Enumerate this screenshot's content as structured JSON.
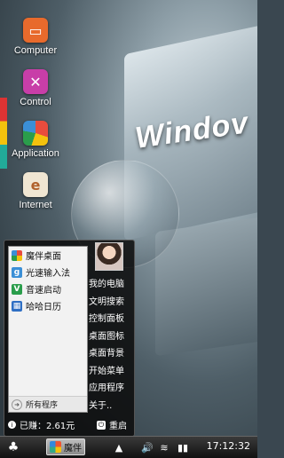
{
  "desktop_icons": [
    {
      "label": "Computer",
      "icon": "computer-icon",
      "color": "#e86a2c"
    },
    {
      "label": "Control",
      "icon": "tools-icon",
      "color": "#c83ea8"
    },
    {
      "label": "Application",
      "icon": "application-icon",
      "color": "#c0392b"
    },
    {
      "label": "Internet",
      "icon": "internet-icon",
      "color": "#f0e6d2"
    }
  ],
  "wallpaper": {
    "logo_text": "Windov"
  },
  "start_menu": {
    "apps": [
      {
        "label": "魔伴桌面",
        "icon": "mobanzhuomian-icon",
        "color": "#e84c3d"
      },
      {
        "label": "光速输入法",
        "icon": "input-method-icon",
        "color": "#3b8fd6"
      },
      {
        "label": "音速启动",
        "icon": "launcher-icon",
        "color": "#2a9d4b"
      },
      {
        "label": "哈哈日历",
        "icon": "calendar-icon",
        "color": "#2f6fc4"
      }
    ],
    "all_programs": "所有程序",
    "right_items": [
      "我的电脑",
      "文明搜索",
      "控制面板",
      "桌面图标",
      "桌面背景",
      "开始菜单",
      "应用程序",
      "关于.."
    ],
    "earned": "已赚：2.61元",
    "restart": "重启"
  },
  "taskbar": {
    "task_label": "魔伴",
    "clock": "17:12:32",
    "tray": [
      "arrow-up-icon",
      "volume-icon",
      "wifi-icon",
      "battery-icon"
    ]
  }
}
